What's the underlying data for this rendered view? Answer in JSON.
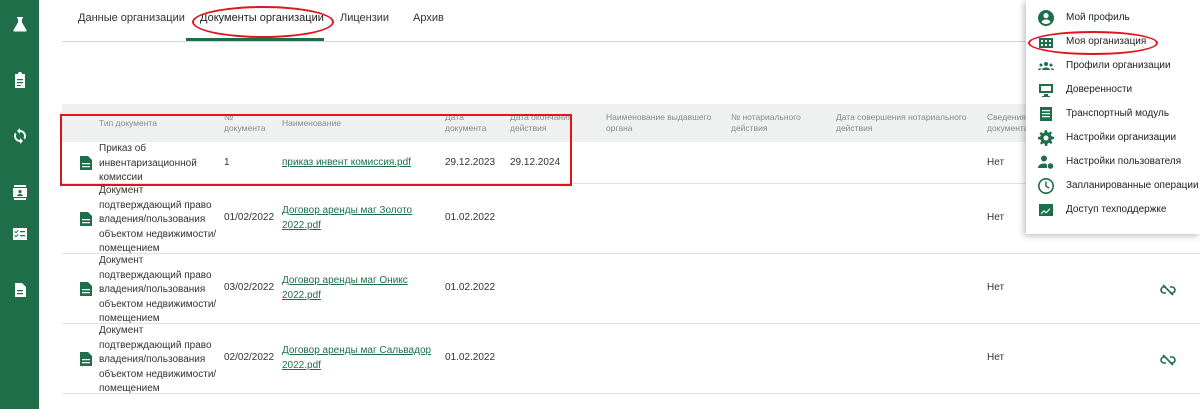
{
  "sidebar": {
    "icons": [
      "flask-icon",
      "clipboard-icon",
      "sync-icon",
      "contact-card-icon",
      "checklist-icon",
      "document-icon"
    ]
  },
  "tabs": [
    {
      "label": "Данные организации"
    },
    {
      "label": "Документы организации"
    },
    {
      "label": "Лицензии"
    },
    {
      "label": "Архив"
    }
  ],
  "table": {
    "headers": {
      "type": "Тип документа",
      "number": "№ документа",
      "name": "Наименование",
      "date": "Дата документа",
      "end_date": "Дата окончания действия",
      "issuer": "Наименование выдавшего органа",
      "notary_no": "№ нотариального действия",
      "notary_date": "Дата совершения нотариального действия",
      "info": "Сведения о документах"
    },
    "rows": [
      {
        "type": "Приказ об инвентаризационной комиссии",
        "number": "1",
        "name": "приказ инвент комиссия.pdf",
        "date": "29.12.2023",
        "end_date": "29.12.2024",
        "info": "Нет"
      },
      {
        "type": "Документ подтверждающий право владения/пользования объектом недвижимости/помещением",
        "number": "01/02/2022",
        "name": "Договор аренды маг Золото 2022.pdf",
        "date": "01.02.2022",
        "end_date": "",
        "info": "Нет"
      },
      {
        "type": "Документ подтверждающий право владения/пользования объектом недвижимости/помещением",
        "number": "03/02/2022",
        "name": "Договор аренды маг Оникс 2022.pdf",
        "date": "01.02.2022",
        "end_date": "",
        "info": "Нет"
      },
      {
        "type": "Документ подтверждающий право владения/пользования объектом недвижимости/помещением",
        "number": "02/02/2022",
        "name": "Договор аренды маг Сальвадор 2022.pdf",
        "date": "01.02.2022",
        "end_date": "",
        "info": "Нет"
      }
    ]
  },
  "menu": {
    "items": [
      {
        "label": "Мой профиль",
        "icon": "account-circle-icon"
      },
      {
        "label": "Моя организация",
        "icon": "building-icon"
      },
      {
        "label": "Профили организации",
        "icon": "group-icon"
      },
      {
        "label": "Доверенности",
        "icon": "monitor-icon"
      },
      {
        "label": "Транспортный модуль",
        "icon": "list-box-icon"
      },
      {
        "label": "Настройки организации",
        "icon": "gear-icon"
      },
      {
        "label": "Настройки пользователя",
        "icon": "user-gear-icon"
      },
      {
        "label": "Запланированные операции",
        "icon": "clock-icon"
      },
      {
        "label": "Доступ техподдержке",
        "icon": "chart-box-icon"
      }
    ]
  },
  "colors": {
    "brand": "#1e6e4a",
    "annotation": "#e0141e"
  }
}
